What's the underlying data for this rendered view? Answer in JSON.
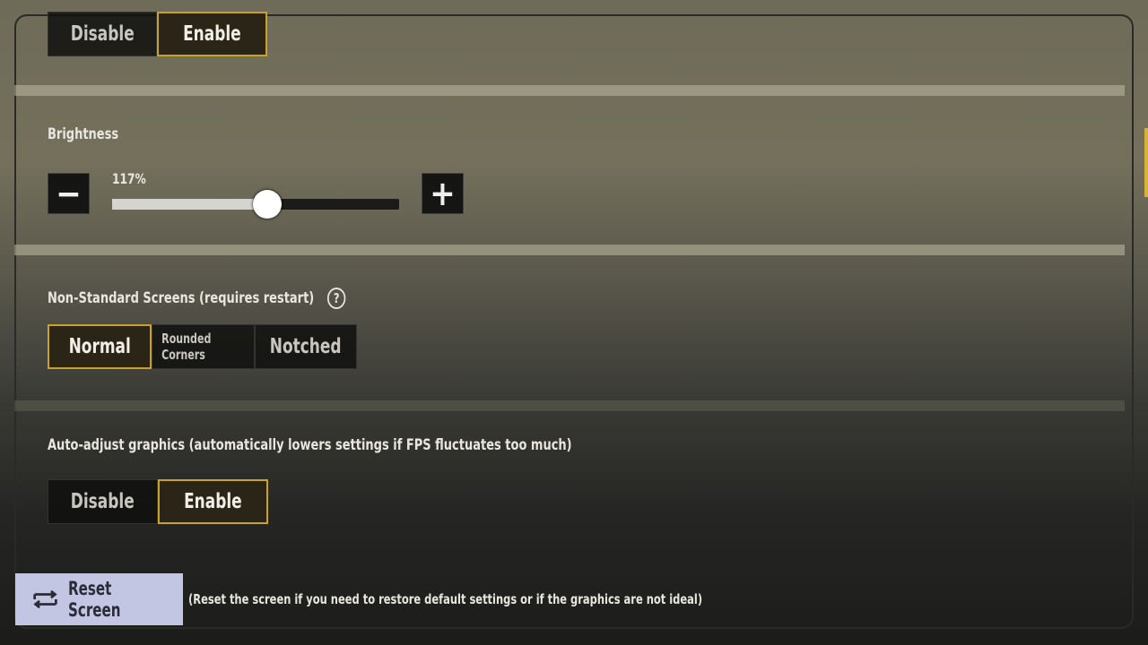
{
  "display_mode": {
    "options": [
      "Disable",
      "Enable"
    ],
    "selected": "Enable"
  },
  "brightness": {
    "label": "Brightness",
    "value_text": "117%",
    "slider_fraction": 0.54,
    "minus_icon": "minus-icon",
    "plus_icon": "plus-icon"
  },
  "non_standard": {
    "label": "Non-Standard Screens (requires restart)",
    "help_icon": "question-circle-icon",
    "options": [
      "Normal",
      "Rounded Corners",
      "Notched"
    ],
    "selected": "Normal"
  },
  "auto_adjust": {
    "label": "Auto-adjust graphics (automatically lowers settings if FPS fluctuates too much)",
    "options": [
      "Disable",
      "Enable"
    ],
    "selected": "Enable"
  },
  "reset": {
    "label": "Reset Screen",
    "icon": "reset-loop-icon",
    "description": "(Reset the screen if you need to restore default settings or if the graphics are not ideal)"
  },
  "colors": {
    "accent": "#c9a227",
    "reset_button": "#c3c6e2",
    "scrollbar": "#d7b23a"
  }
}
